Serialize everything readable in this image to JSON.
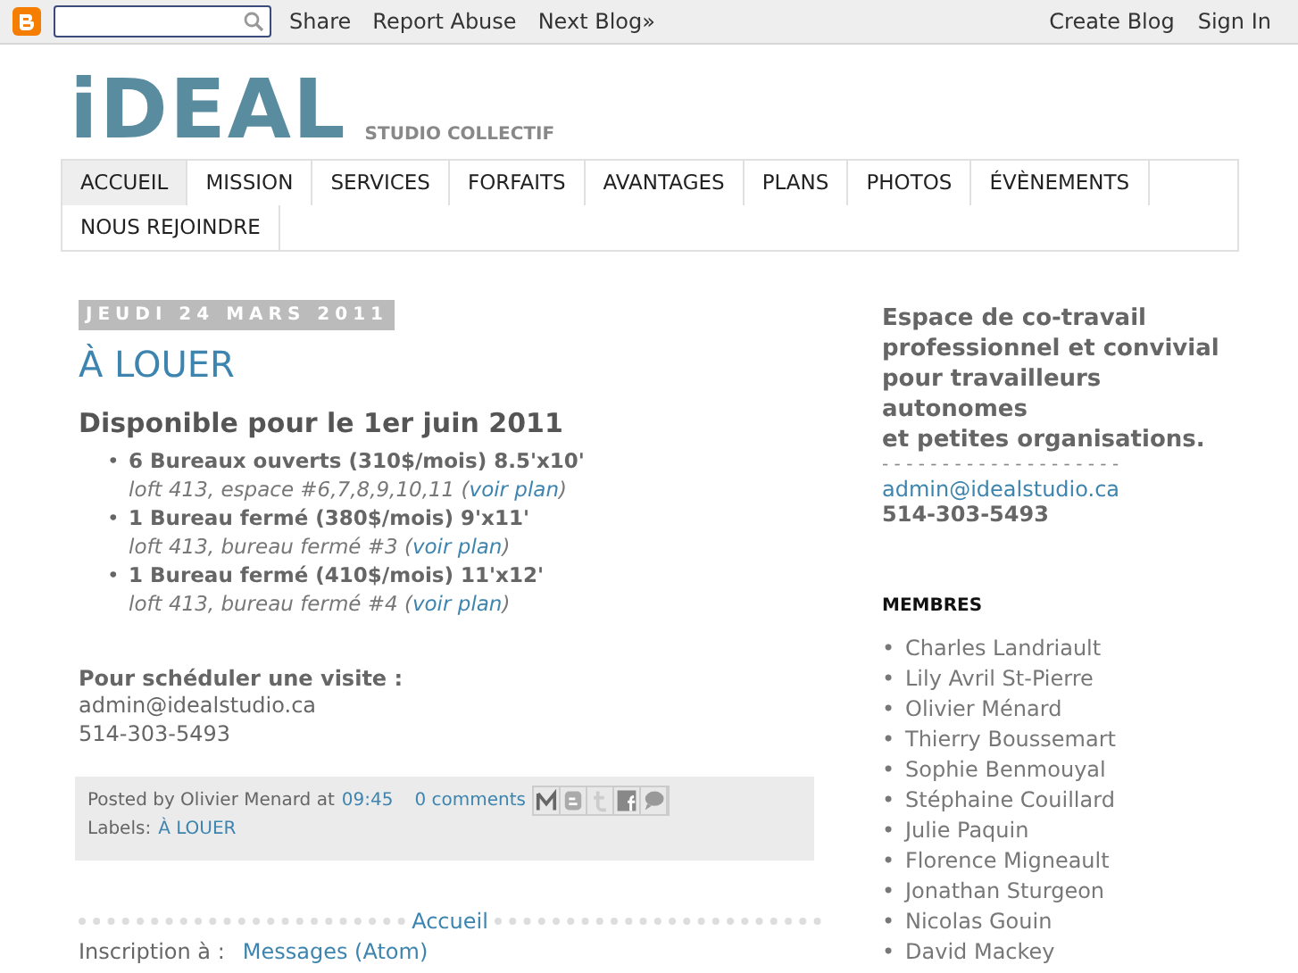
{
  "navbar": {
    "links": [
      "Share",
      "Report Abuse",
      "Next Blog»"
    ],
    "right_links": [
      "Create Blog",
      "Sign In"
    ]
  },
  "header": {
    "logo": "iDEAL",
    "tagline": "STUDIO COLLECTIF"
  },
  "tabs": [
    {
      "label": "ACCUEIL",
      "selected": true
    },
    {
      "label": "MISSION",
      "selected": false
    },
    {
      "label": "SERVICES",
      "selected": false
    },
    {
      "label": "FORFAITS",
      "selected": false
    },
    {
      "label": "AVANTAGES",
      "selected": false
    },
    {
      "label": "PLANS",
      "selected": false
    },
    {
      "label": "PHOTOS",
      "selected": false
    },
    {
      "label": "ÉVÈNEMENTS",
      "selected": false
    },
    {
      "label": "NOUS REJOINDRE",
      "selected": false
    }
  ],
  "post": {
    "date": "JEUDI 24 MARS 2011",
    "title": "À LOUER",
    "heading": "Disponible pour le 1er juin 2011",
    "bullet": "•",
    "items": [
      {
        "title": "6 Bureaux ouverts (310$/mois) 8.5'x10'",
        "detail": "loft 413, espace #6,7,8,9,10,11 (",
        "link": "voir plan",
        "close": ")"
      },
      {
        "title": "1 Bureau fermé (380$/mois) 9'x11'",
        "detail": "loft 413, bureau fermé #3 (",
        "link": "voir plan",
        "close": ")"
      },
      {
        "title": "1 Bureau fermé (410$/mois) 11'x12'",
        "detail": "loft 413, bureau fermé #4 (",
        "link": "voir plan",
        "close": ")"
      }
    ],
    "visit_label": "Pour schéduler une visite :",
    "email": "admin@idealstudio.ca",
    "phone": "514-303-5493",
    "footer": {
      "posted_by": "Posted by Olivier Menard at",
      "time": "09:45",
      "comments": "0 comments",
      "labels_prefix": "Labels:",
      "label": "À LOUER"
    }
  },
  "pager": {
    "home": "Accueil"
  },
  "subscribe": {
    "prefix": "Inscription à :",
    "link": "Messages (Atom)"
  },
  "sidebar": {
    "description": [
      "Espace de co-travail",
      "professionnel et convivial",
      "pour travailleurs",
      "autonomes",
      "et petites organisations."
    ],
    "separator": "- - - - - - - - - - - - - - - - - - - -",
    "email": "admin@idealstudio.ca",
    "phone": "514-303-5493",
    "members_title": "MEMBRES",
    "bullet": "•",
    "members": [
      "Charles Landriault",
      "Lily Avril St-Pierre",
      "Olivier Ménard",
      "Thierry Boussemart",
      "Sophie Benmouyal",
      "Stéphaine Couillard",
      "Julie Paquin",
      "Florence Migneault",
      "Jonathan Sturgeon",
      "Nicolas Gouin",
      "David Mackey"
    ]
  }
}
